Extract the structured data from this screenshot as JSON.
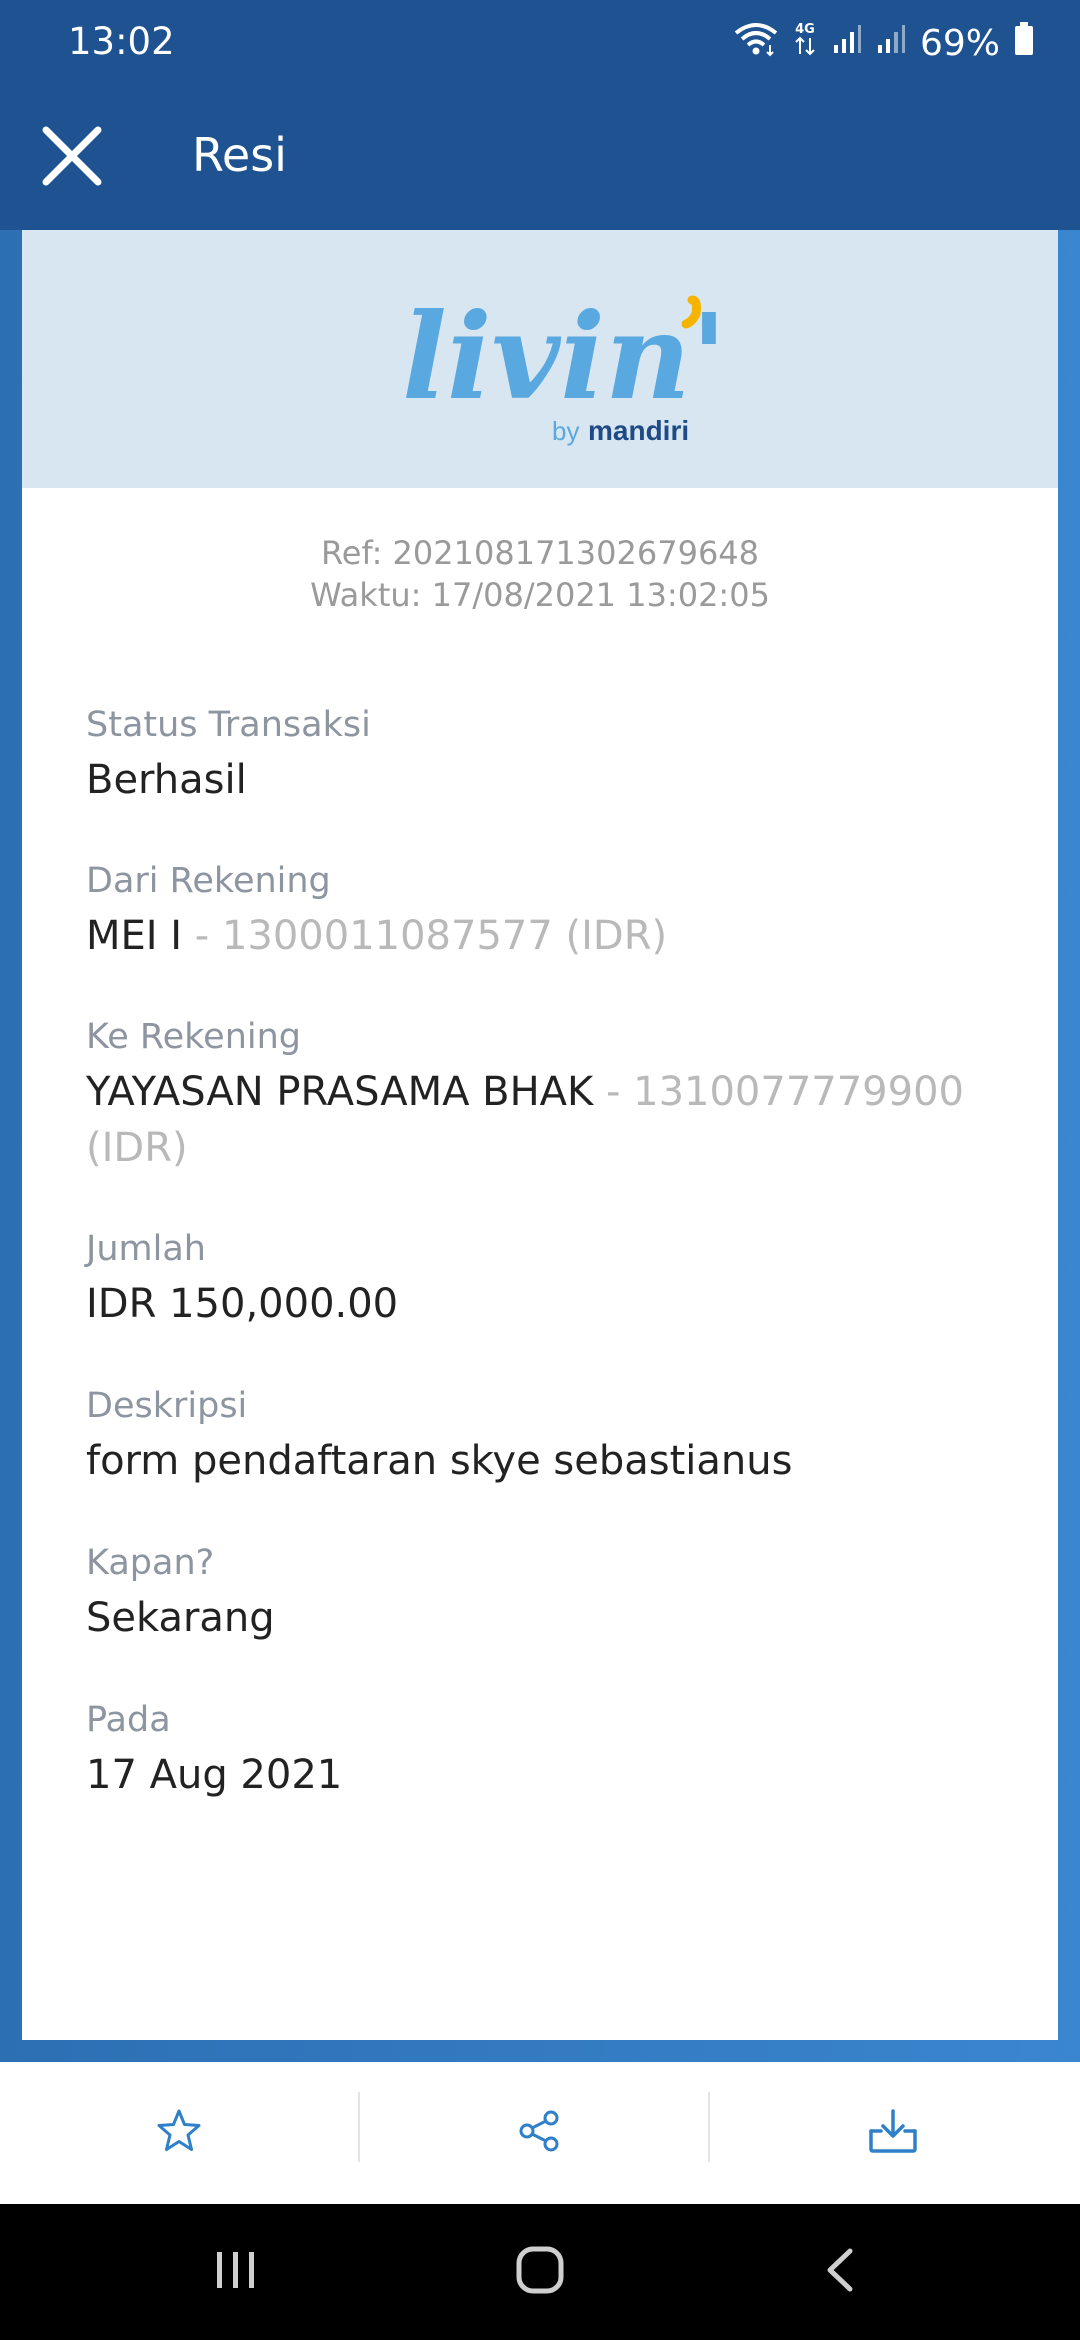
{
  "status_bar": {
    "time": "13:02",
    "battery": "69%",
    "network": "4G",
    "icons": [
      "wifi-icon",
      "4g-icon",
      "signal-icon",
      "signal-icon",
      "battery-icon"
    ]
  },
  "app_bar": {
    "title": "Resi",
    "close_icon": "close-icon"
  },
  "logo": {
    "wordmark": "livin'",
    "by": "by",
    "brand": "mandiri",
    "colors": {
      "wordmark": "#5aa8e0",
      "accent": "#f5b400",
      "brand": "#1e4a86"
    }
  },
  "receipt": {
    "ref": "Ref: 20210817130267964 8",
    "time": "Waktu: 17/08/2021 13:02:05",
    "fields": [
      {
        "label": "Status Transaksi",
        "value": "Berhasil",
        "suffix": ""
      },
      {
        "label": "Dari Rekening",
        "value": "MEI I",
        "suffix": " - 1300011087577 (IDR)"
      },
      {
        "label": "Ke Rekening",
        "value": "YAYASAN PRASAMA BHAK",
        "suffix": " - 1310077779900 (IDR)"
      },
      {
        "label": "Jumlah",
        "value": "IDR 150,000.00",
        "suffix": ""
      },
      {
        "label": "Deskripsi",
        "value": "form pendaftaran skye sebastianus",
        "suffix": ""
      },
      {
        "label": "Kapan?",
        "value": "Sekarang",
        "suffix": ""
      },
      {
        "label": "Pada",
        "value": "17 Aug 2021",
        "suffix": ""
      }
    ]
  },
  "actions": {
    "items": [
      {
        "icon": "star-icon"
      },
      {
        "icon": "share-icon"
      },
      {
        "icon": "download-icon"
      }
    ],
    "color": "#2f80c8"
  },
  "nav_bar": {
    "items": [
      "recent-apps-icon",
      "home-icon",
      "back-icon"
    ]
  }
}
